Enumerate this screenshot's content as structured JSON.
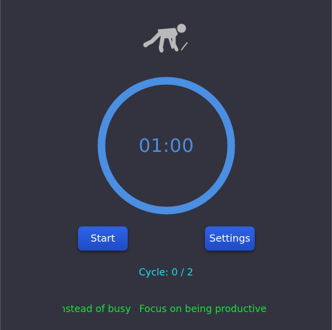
{
  "timer": {
    "display": "01:00",
    "ring_color": "#4a8fe2"
  },
  "buttons": {
    "start_label": "Start",
    "settings_label": "Settings"
  },
  "cycle": {
    "text": "Cycle: 0 / 2"
  },
  "ticker": {
    "message_1": "Instead of busy",
    "message_2": "Focus on being productive"
  },
  "icons": {
    "header": "runner-start-icon"
  },
  "colors": {
    "background": "#33323f",
    "button": "#2753d8",
    "cycle_text": "#19e2ec",
    "ticker_text": "#12e636"
  }
}
